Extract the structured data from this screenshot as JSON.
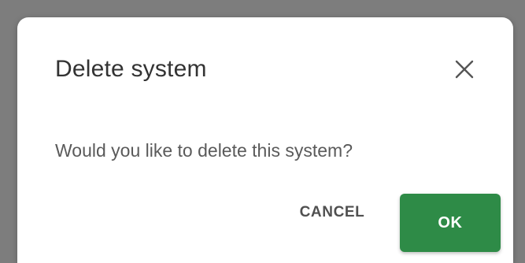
{
  "dialog": {
    "title": "Delete system",
    "message": "Would you like to delete this system?",
    "close_icon": "close-icon",
    "buttons": {
      "cancel_label": "CANCEL",
      "ok_label": "OK"
    }
  },
  "colors": {
    "backdrop": "#7d7d7d",
    "dialog_background": "#ffffff",
    "primary_button": "#2e8b47",
    "title_text": "#333333",
    "body_text": "#5a5a5a"
  }
}
